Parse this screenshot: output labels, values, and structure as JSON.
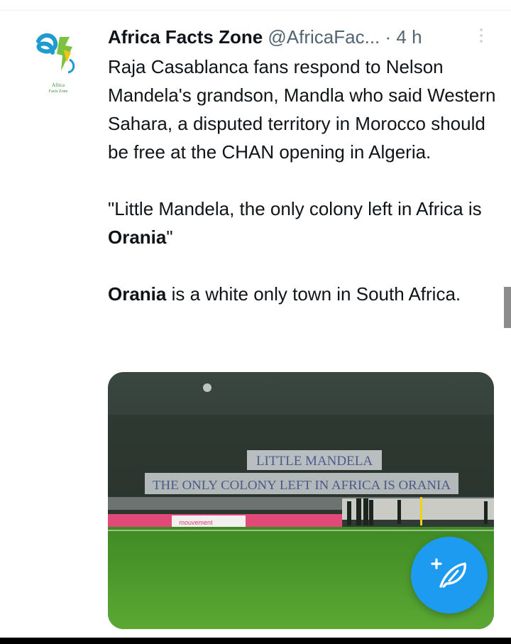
{
  "tweet": {
    "author_name": "Africa Facts Zone",
    "author_handle": "@AfricaFac...",
    "separator": "·",
    "time": "4 h",
    "avatar_label": [
      "Africa",
      "Facts Zone"
    ],
    "paragraph_1": "Raja Casablanca fans respond to Nelson Mandela's grandson, Mandla who said Western Sahara, a disputed territory in Morocco should be free at the CHAN opening in Algeria.",
    "paragraph_2_prefix": "\"Little Mandela, the only colony left in Africa is ",
    "paragraph_2_bold": "Orania",
    "paragraph_2_suffix": "\"",
    "paragraph_3_bold": "Orania",
    "paragraph_3_rest": " is a white only town in South Africa."
  },
  "media": {
    "banner_line_1": "LITTLE MANDELA",
    "banner_line_2": "THE ONLY COLONY LEFT IN AFRICA IS ORANIA",
    "board_text": "mouvement"
  },
  "colors": {
    "accent": "#1d9bf0",
    "pitch": "#4f9a2c",
    "ad_board": "#e04a78",
    "secondary_text": "#536471"
  },
  "icons": {
    "compose": "compose-feather-icon",
    "more": "more-options-icon"
  }
}
